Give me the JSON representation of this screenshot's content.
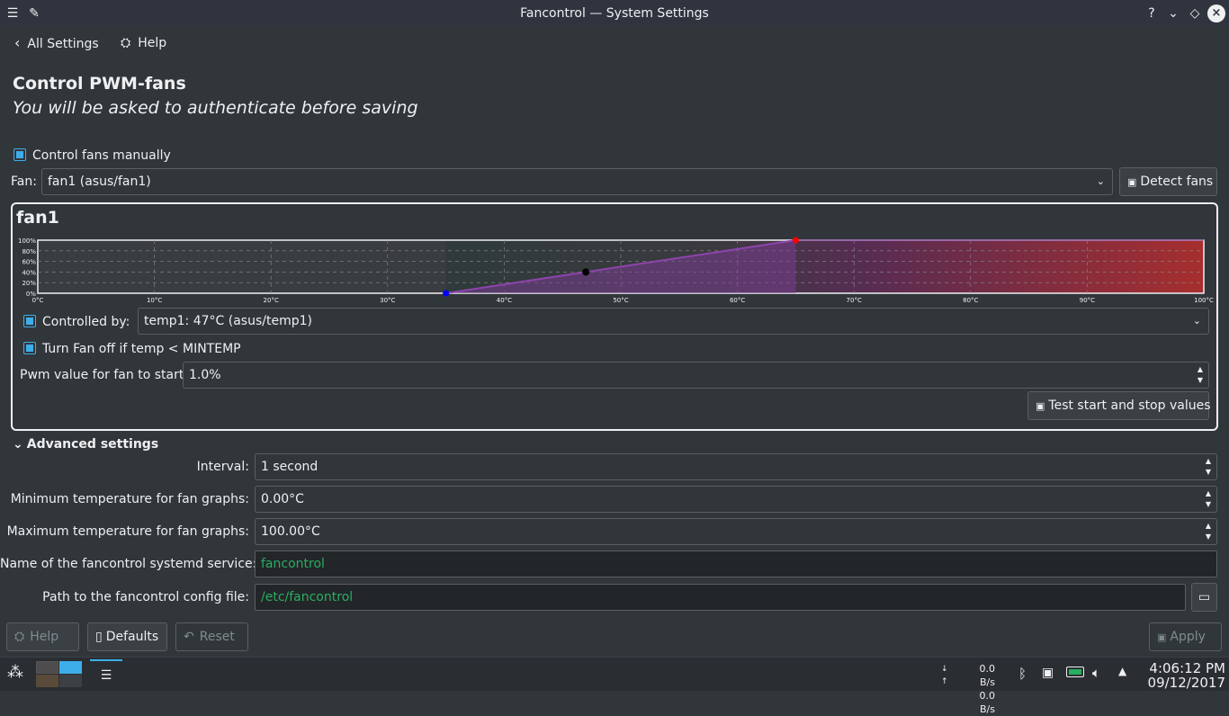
{
  "window": {
    "title": "Fancontrol — System Settings"
  },
  "nav": {
    "back_label": "All Settings",
    "help_label": "Help"
  },
  "page": {
    "heading": "Control PWM-fans",
    "subheading": "You will be asked to authenticate before saving"
  },
  "control_manually": {
    "label": "Control fans manually",
    "checked": true
  },
  "fan_select": {
    "label": "Fan:",
    "value": "fan1  (asus/fan1)"
  },
  "detect_fans": {
    "label": "Detect fans"
  },
  "fan_panel": {
    "title": "fan1",
    "controlled_by_label": "Controlled by:",
    "controlled_by_value": "temp1: 47°C   (asus/temp1)",
    "turn_off_label": "Turn Fan off if temp < MINTEMP",
    "pwm_start_label": "Pwm value for fan to start:",
    "pwm_start_value": "1.0%",
    "test_button": "Test start and stop values"
  },
  "chart_data": {
    "type": "line",
    "x_ticks": [
      "0°C",
      "10°C",
      "20°C",
      "30°C",
      "40°C",
      "50°C",
      "60°C",
      "70°C",
      "80°C",
      "90°C",
      "100°C"
    ],
    "y_ticks": [
      "0%",
      "20%",
      "40%",
      "60%",
      "80%",
      "100%"
    ],
    "xlim": [
      0,
      100
    ],
    "ylim": [
      0,
      100
    ],
    "curve": {
      "min_temp": 35,
      "max_temp": 65,
      "min_pwm": 0,
      "max_pwm": 100
    },
    "current": {
      "temp": 47,
      "pwm": 40
    },
    "grid": true,
    "colors": {
      "min_point": "#0000ff",
      "max_point": "#ff0000",
      "current_point": "#000000",
      "line": "#8e44ad"
    }
  },
  "advanced": {
    "title": "Advanced settings",
    "interval_label": "Interval:",
    "interval_value": "1 second",
    "min_temp_label": "Minimum temperature for fan graphs:",
    "min_temp_value": "0.00°C",
    "max_temp_label": "Maximum temperature for fan graphs:",
    "max_temp_value": "100.00°C",
    "service_label": "Name of the fancontrol systemd service:",
    "service_value": "fancontrol",
    "config_label": "Path to the fancontrol config file:",
    "config_value": "/etc/fancontrol"
  },
  "footer": {
    "help": "Help",
    "defaults": "Defaults",
    "reset": "Reset",
    "apply": "Apply"
  },
  "taskbar": {
    "net_down": "0.0 B/s",
    "net_up": "0.0 B/s",
    "time": "4:06:12 PM",
    "date": "09/12/2017"
  },
  "colors": {
    "accent": "#3daee9",
    "background": "#31363b",
    "field_text": "#27ae60"
  }
}
